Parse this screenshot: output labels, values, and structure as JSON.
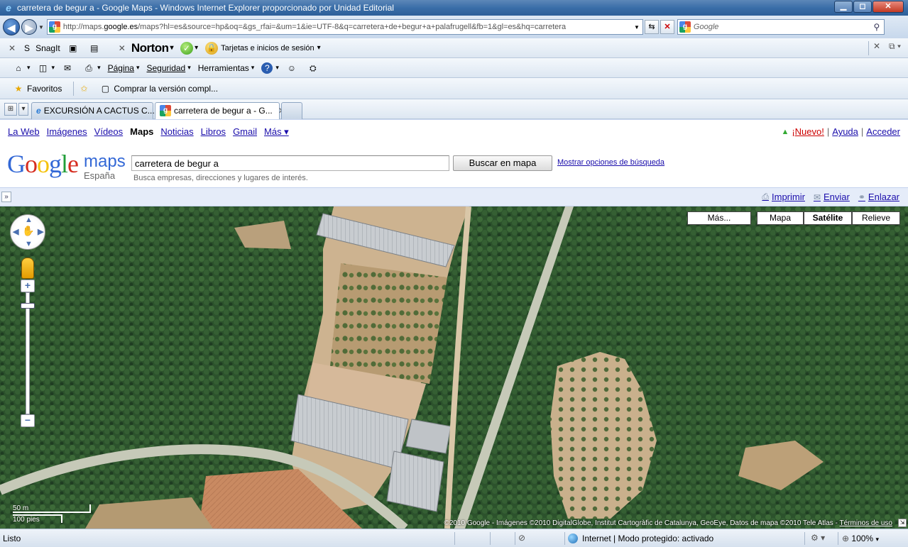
{
  "window": {
    "title": "carretera de begur a - Google Maps - Windows Internet Explorer proporcionado por Unidad Editorial",
    "minimize": "▁",
    "maximize": "◻",
    "close": "✕"
  },
  "address": {
    "url_prefix": "http://maps.",
    "url_domain": "google.es",
    "url_rest": "/maps?hl=es&source=hp&oq=&gs_rfai=&um=1&ie=UTF-8&q=carretera+de+begur+a+palafrugell&fb=1&gl=es&hq=carretera",
    "search_placeholder": "Google"
  },
  "toolbar1": {
    "snagit": "SnagIt",
    "norton": "Norton",
    "cards": "Tarjetas e inicios de sesión"
  },
  "toolbar2": {
    "page": "Página",
    "security": "Seguridad",
    "tools": "Herramientas"
  },
  "toolbar3": {
    "favorites": "Favoritos",
    "buy": "Comprar la versión compl..."
  },
  "tabs": [
    {
      "label": "EXCURSIÓN A CACTUS C..."
    },
    {
      "label": "carretera de begur a - G..."
    }
  ],
  "gbar": {
    "links": [
      "La Web",
      "Imágenes",
      "Vídeos",
      "Maps",
      "Noticias",
      "Libros",
      "Gmail",
      "Más ▾"
    ],
    "new": "¡Nuevo!",
    "help": "Ayuda",
    "signin": "Acceder",
    "sep": "|"
  },
  "maps": {
    "logo_google": "Google",
    "logo_maps": "maps",
    "logo_country": "España",
    "query": "carretera de begur a",
    "hint": "Busca empresas, direcciones y lugares de interés.",
    "search_btn": "Buscar en mapa",
    "options_link": "Mostrar opciones de búsqueda"
  },
  "mapbar": {
    "toggle": "»",
    "print": "Imprimir",
    "send": "Enviar",
    "link": "Enlazar"
  },
  "maptypes": {
    "more": "Más...",
    "map": "Mapa",
    "satellite": "Satélite",
    "terrain": "Relieve"
  },
  "map": {
    "scale_m": "50 m",
    "scale_ft": "100 pies",
    "copyright": "©2010 Google - Imágenes ©2010 DigitalGlobe, Institut Cartogràfic de Catalunya, GeoEye, Datos de mapa ©2010 Tele Atlas - ",
    "terms": "Términos de uso",
    "zoom_plus": "+",
    "zoom_minus": "−"
  },
  "status": {
    "ready": "Listo",
    "zone": "Internet | Modo protegido: activado",
    "zoom": "100%"
  }
}
